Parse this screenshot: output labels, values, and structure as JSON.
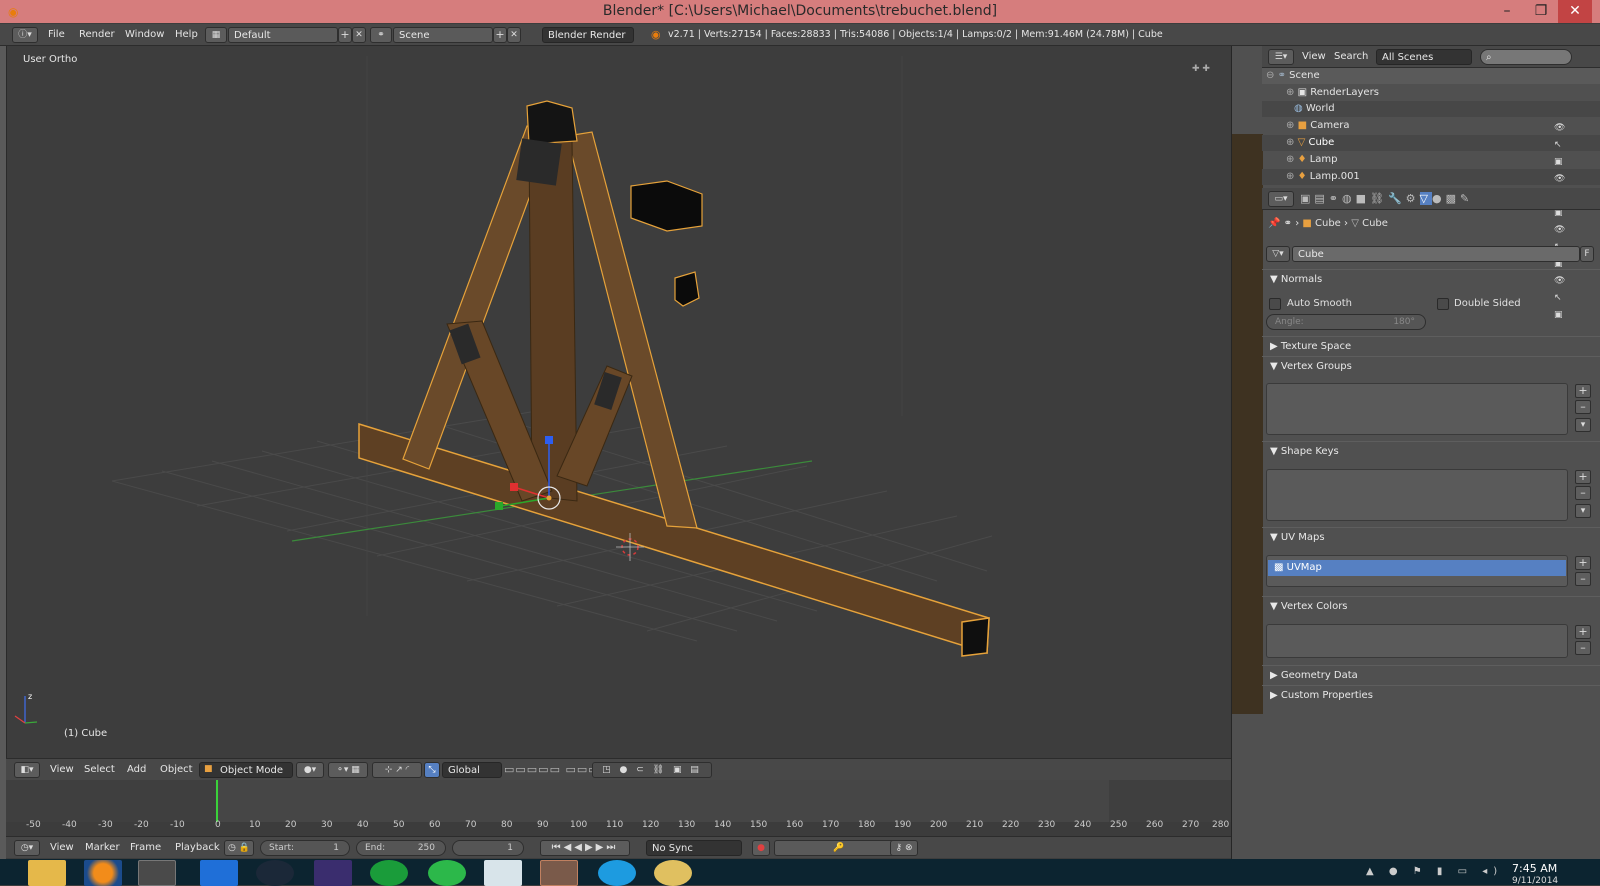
{
  "title_bar": {
    "title": "Blender* [C:\\Users\\Michael\\Documents\\trebuchet.blend]",
    "minimize": "–",
    "maximize": "❐",
    "close": "✕"
  },
  "info_header": {
    "menus": [
      "File",
      "Render",
      "Window",
      "Help"
    ],
    "layout": "Default",
    "scene": "Scene",
    "engine": "Blender Render",
    "stats": "v2.71 | Verts:27154 | Faces:28833 | Tris:54086 | Objects:1/4 | Lamps:0/2 | Mem:91.46M (24.78M) | Cube"
  },
  "viewport": {
    "view_name": "User Ortho",
    "object_label": "(1) Cube",
    "axis_z": "z"
  },
  "outliner": {
    "menus": [
      "View",
      "Search"
    ],
    "filter": "All Scenes",
    "rows": [
      "Scene",
      "RenderLayers",
      "World",
      "Camera",
      "Cube",
      "Lamp",
      "Lamp.001"
    ]
  },
  "properties": {
    "breadcrumb": [
      "Cube",
      "Cube"
    ],
    "mesh_name": "Cube",
    "fake_user": "F",
    "panels": {
      "normals": "Normals",
      "auto_smooth": "Auto Smooth",
      "double_sided": "Double Sided",
      "angle_label": "Angle:",
      "angle_value": "180°",
      "texture_space": "Texture Space",
      "vertex_groups": "Vertex Groups",
      "shape_keys": "Shape Keys",
      "uv_maps": "UV Maps",
      "uv_map_item": "UVMap",
      "vertex_colors": "Vertex Colors",
      "geometry_data": "Geometry Data",
      "custom_properties": "Custom Properties"
    }
  },
  "view3d_header": {
    "menus": [
      "View",
      "Select",
      "Add",
      "Object"
    ],
    "mode": "Object Mode",
    "orientation": "Global"
  },
  "timeline": {
    "ticks": [
      "-50",
      "-40",
      "-30",
      "-20",
      "-10",
      "0",
      "10",
      "20",
      "30",
      "40",
      "50",
      "60",
      "70",
      "80",
      "90",
      "100",
      "110",
      "120",
      "130",
      "140",
      "150",
      "160",
      "170",
      "180",
      "190",
      "200",
      "210",
      "220",
      "230",
      "240",
      "250",
      "260",
      "270",
      "280"
    ],
    "menus": [
      "View",
      "Marker",
      "Frame",
      "Playback"
    ],
    "start_label": "Start:",
    "start": "1",
    "end_label": "End:",
    "end": "250",
    "current": "1",
    "sync": "No Sync"
  },
  "taskbar": {
    "time": "7:45 AM",
    "date": "9/11/2014"
  },
  "colors": {
    "accent": "#e87d0d",
    "selection": "#5680c2",
    "title": "#d67d7d"
  }
}
